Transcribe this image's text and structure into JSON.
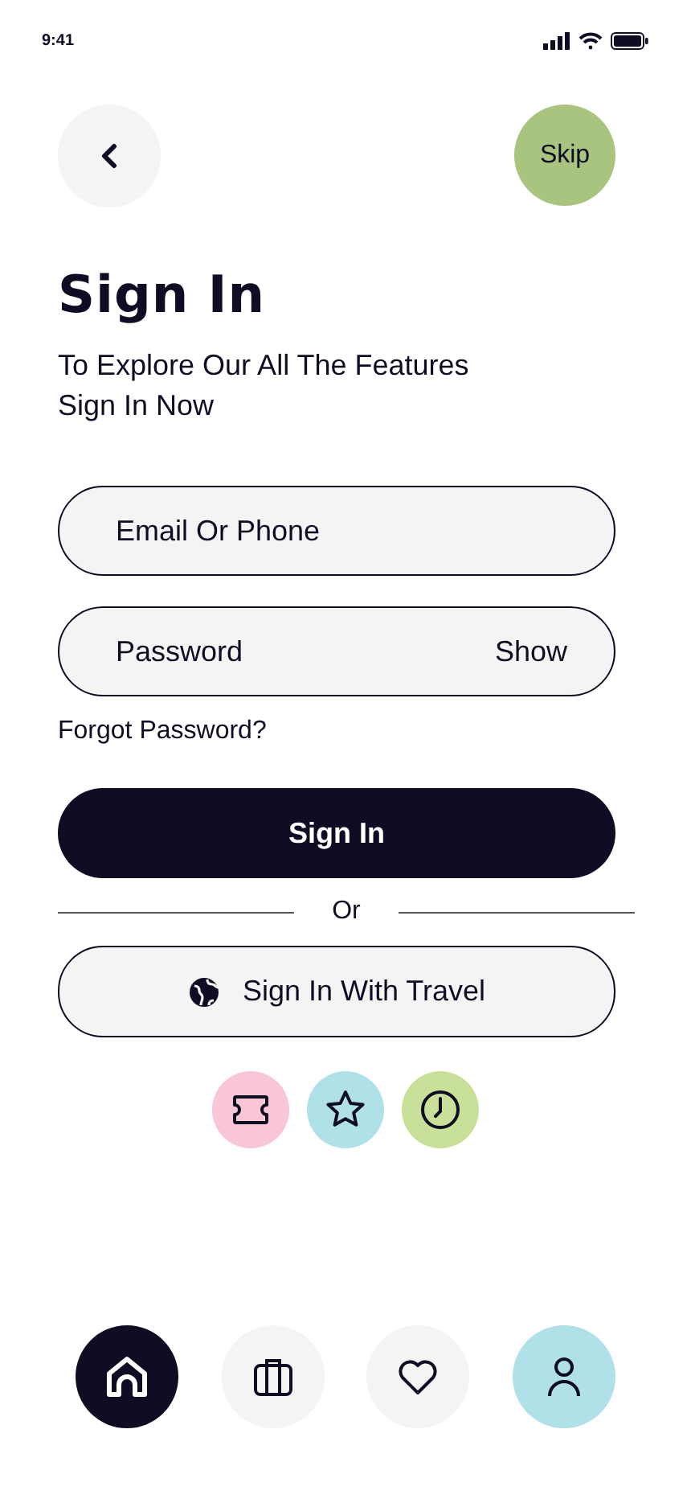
{
  "status_bar": {
    "time": "9:41"
  },
  "header": {
    "skip": "Skip"
  },
  "title": "Sign In",
  "subtitle": "To Explore Our All The Features Sign In Now",
  "fields": [
    {
      "placeholder": "Email Or Phone"
    },
    {
      "placeholder": "Password",
      "action": "Show"
    }
  ],
  "forgot": "Forgot Password?",
  "primary_button": "Sign In",
  "divider": "Or",
  "travel_button": "Sign In With Travel",
  "socials": [
    {
      "kind": "ticket",
      "color": "#f8c6d4"
    },
    {
      "kind": "star",
      "color": "#b0e0e8"
    },
    {
      "kind": "clock",
      "color": "#c8e09a"
    }
  ],
  "nav": [
    {
      "kind": "home",
      "selected": true
    },
    {
      "kind": "bag",
      "selected": false,
      "color": "#f4f4f4"
    },
    {
      "kind": "heart",
      "selected": false,
      "color": "#f4f4f4"
    },
    {
      "kind": "profile",
      "selected": false,
      "color": "#b0e0e8"
    }
  ]
}
